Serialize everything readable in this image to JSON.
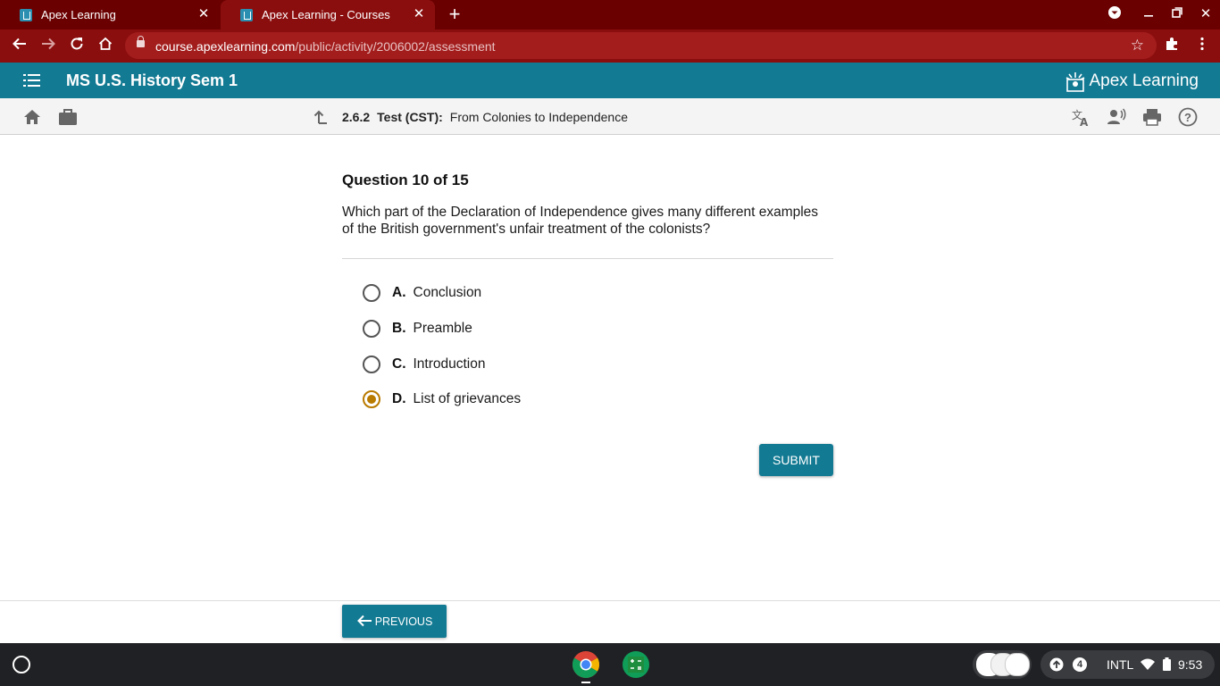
{
  "browser": {
    "tabs": [
      {
        "title": "Apex Learning",
        "active": false
      },
      {
        "title": "Apex Learning - Courses",
        "active": true
      }
    ],
    "url_host": "course.apexlearning.com",
    "url_path": "/public/activity/2006002/assessment"
  },
  "header": {
    "course_title": "MS U.S. History Sem 1",
    "logo_text": "Apex Learning"
  },
  "subheader": {
    "activity_number": "2.6.2",
    "activity_type": "Test (CST):",
    "activity_title": "From Colonies to Independence"
  },
  "question": {
    "heading": "Question 10 of 15",
    "text": "Which part of the Declaration of Independence gives many different examples of the British government's unfair treatment of the colonists?",
    "options": [
      {
        "letter": "A.",
        "text": "Conclusion",
        "selected": false
      },
      {
        "letter": "B.",
        "text": "Preamble",
        "selected": false
      },
      {
        "letter": "C.",
        "text": "Introduction",
        "selected": false
      },
      {
        "letter": "D.",
        "text": "List of grievances",
        "selected": true
      }
    ],
    "submit_label": "SUBMIT"
  },
  "footer": {
    "previous_label": "PREVIOUS"
  },
  "shelf": {
    "notification_count": "4",
    "keyboard": "INTL",
    "time": "9:53"
  },
  "colors": {
    "brand_teal": "#137a93",
    "selected_radio": "#b97a00",
    "chrome_frame": "#6b0000"
  }
}
